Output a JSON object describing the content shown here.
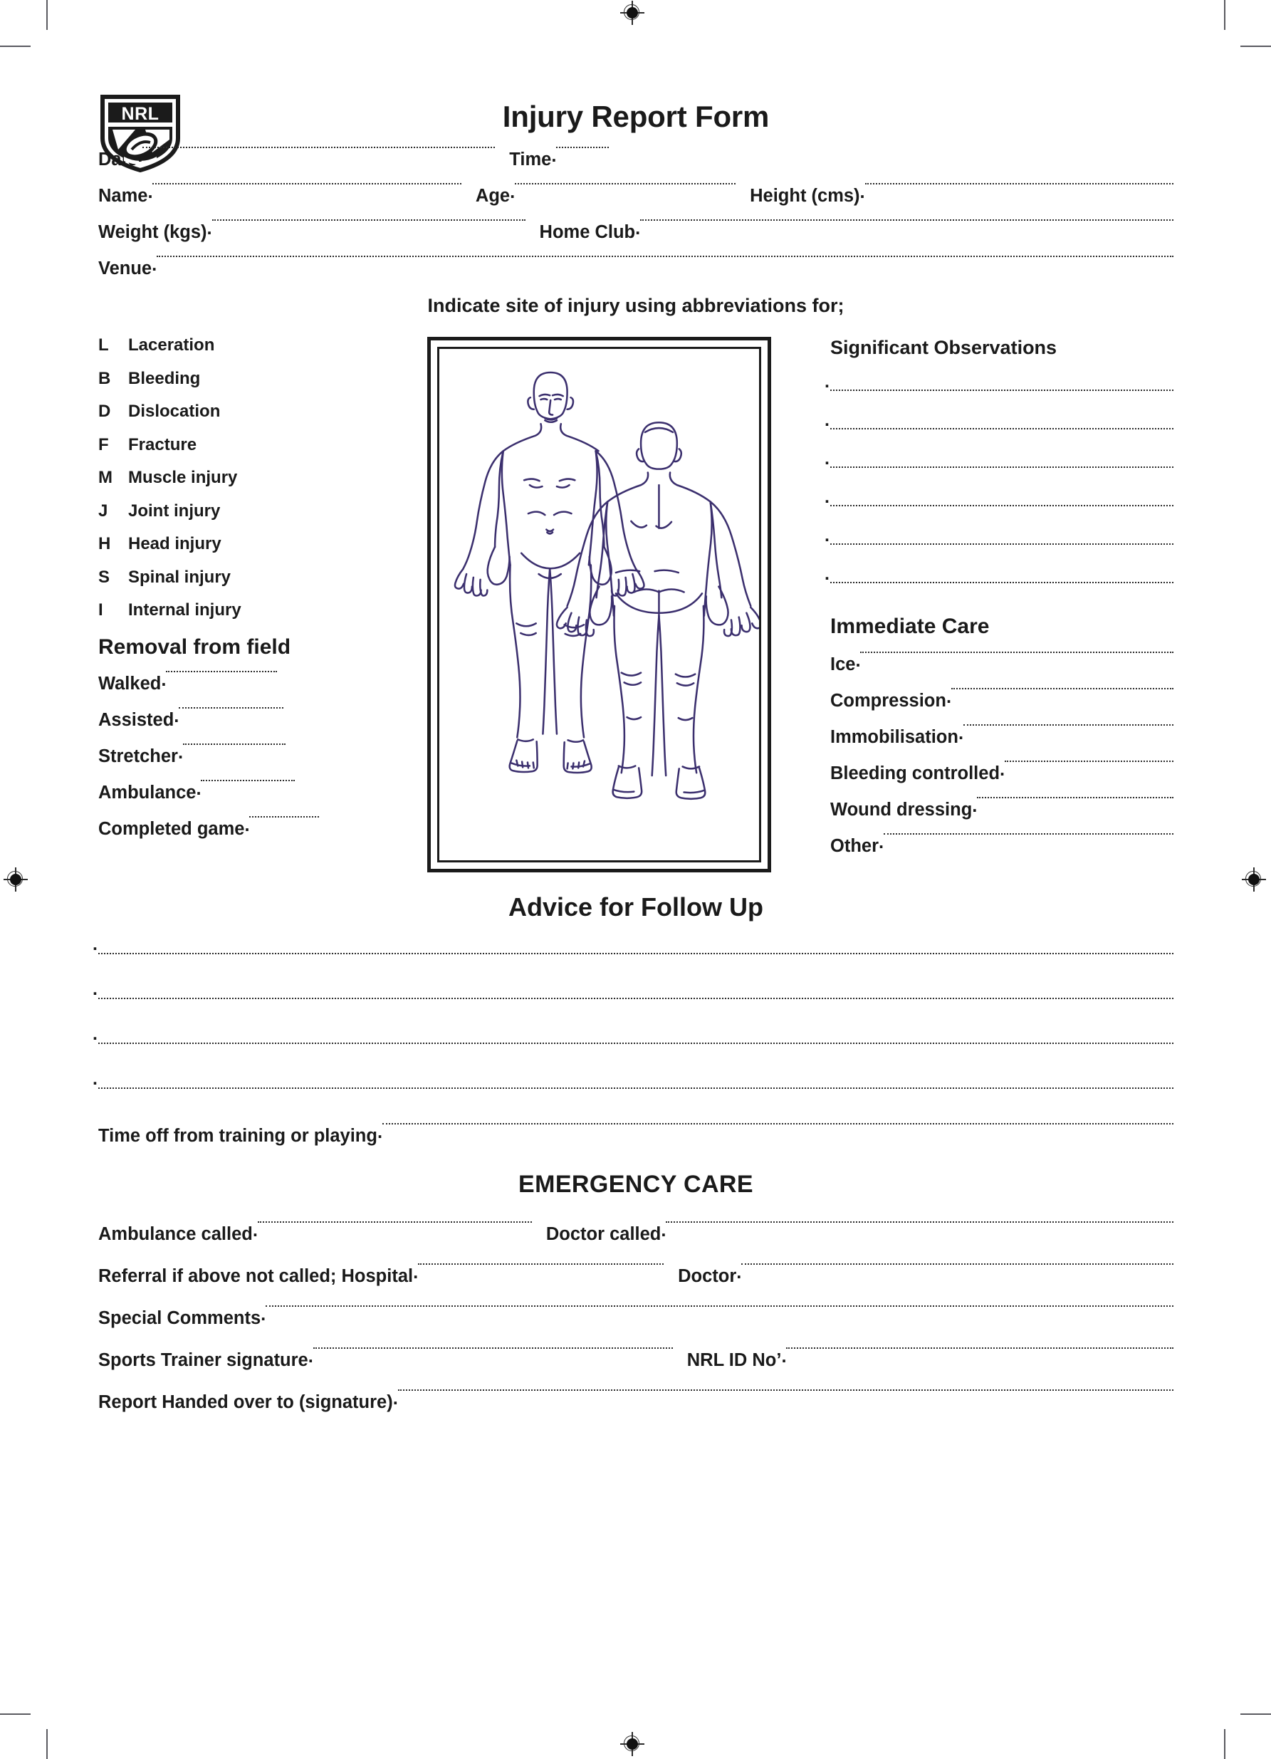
{
  "document": {
    "title": "Injury Report Form",
    "logo_text": "NRL",
    "logo_alt": "nrl-shield-logo"
  },
  "identity": {
    "fields": [
      {
        "label": "Date",
        "value": "",
        "width": "grow"
      },
      {
        "label": "Time",
        "value": "",
        "width": "90"
      }
    ],
    "row2": [
      {
        "label": "Name",
        "value": ""
      },
      {
        "label": "Age",
        "value": ""
      },
      {
        "label": "Height (cms)",
        "value": ""
      }
    ],
    "row3": [
      {
        "label": "Weight (kgs)",
        "value": ""
      },
      {
        "label": "Home Club",
        "value": ""
      }
    ],
    "row4": [
      {
        "label": "Venue",
        "value": ""
      }
    ]
  },
  "indicate_instruction": "Indicate site of injury using abbreviations for;",
  "legend": {
    "items": [
      {
        "abbr": "L",
        "term": "Laceration"
      },
      {
        "abbr": "B",
        "term": "Bleeding"
      },
      {
        "abbr": "D",
        "term": "Dislocation"
      },
      {
        "abbr": "F",
        "term": "Fracture"
      },
      {
        "abbr": "M",
        "term": "Muscle injury"
      },
      {
        "abbr": "J",
        "term": "Joint injury"
      },
      {
        "abbr": "H",
        "term": "Head injury"
      },
      {
        "abbr": "S",
        "term": "Spinal injury"
      },
      {
        "abbr": "I",
        "term": "Internal injury"
      }
    ]
  },
  "removal_from_field": {
    "heading": "Removal from field",
    "items": [
      {
        "label": "Walked",
        "value": ""
      },
      {
        "label": "Assisted",
        "value": ""
      },
      {
        "label": "Stretcher",
        "value": ""
      },
      {
        "label": "Ambulance",
        "value": ""
      },
      {
        "label": "Completed game",
        "value": ""
      }
    ]
  },
  "body_diagram": {
    "caption": "body-diagram-anterior-and-posterior",
    "ink_color": "#3b2f6e",
    "views": [
      "anterior",
      "posterior"
    ]
  },
  "significant_observations": {
    "heading": "Significant Observations",
    "blank_line_count": 6
  },
  "immediate_care": {
    "heading": "Immediate Care",
    "items": [
      {
        "label": "Ice",
        "value": ""
      },
      {
        "label": "Compression",
        "value": ""
      },
      {
        "label": "Immobilisation",
        "value": ""
      },
      {
        "label": "Bleeding controlled",
        "value": ""
      },
      {
        "label": "Wound dressing",
        "value": ""
      },
      {
        "label": "Other",
        "value": ""
      }
    ]
  },
  "advice_follow_up": {
    "heading": "Advice for Follow Up",
    "blank_line_count": 4,
    "time_off_label": "Time off from training or playing",
    "time_off_value": ""
  },
  "emergency_care": {
    "heading": "EMERGENCY CARE",
    "row1": [
      {
        "label": "Ambulance called",
        "value": ""
      },
      {
        "label": "Doctor called",
        "value": ""
      }
    ],
    "row2": [
      {
        "label": "Referral if above not called;  Hospital",
        "value": ""
      },
      {
        "label": "Doctor",
        "value": ""
      }
    ],
    "row3": [
      {
        "label": "Special Comments",
        "value": ""
      }
    ],
    "row4": [
      {
        "label": "Sports Trainer signature",
        "value": ""
      },
      {
        "label": "NRL ID No’",
        "value": ""
      }
    ],
    "row5": [
      {
        "label": "Report Handed over to (signature)",
        "value": ""
      }
    ]
  },
  "print_marks": {
    "registration_target_name": "registration-target-icon",
    "crop_mark_name": "crop-mark"
  }
}
